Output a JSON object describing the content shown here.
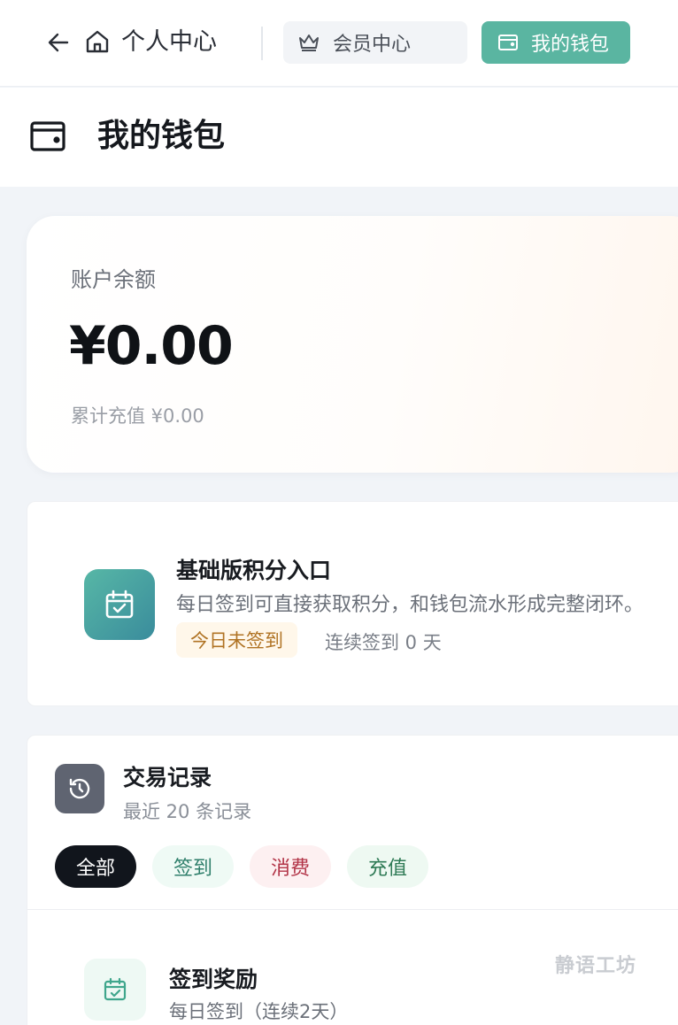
{
  "nav": {
    "title": "个人中心",
    "tabs": [
      {
        "label": "会员中心",
        "icon": "crown-icon"
      },
      {
        "label": "我的钱包",
        "icon": "wallet-icon",
        "active": true
      }
    ],
    "accent": "#5ab5a1"
  },
  "page": {
    "title": "我的钱包",
    "icon": "wallet-icon"
  },
  "balance": {
    "label": "账户余额",
    "amount": "¥0.00",
    "total": "累计充值 ¥0.00"
  },
  "checkin": {
    "title": "基础版积分入口",
    "desc": "每日签到可直接获取积分，和钱包流水形成完整闭环。",
    "status": "今日未签到",
    "streak": "连续签到 0 天",
    "icon": "calendar-check-icon"
  },
  "transactions": {
    "title": "交易记录",
    "subtitle": "最近 20 条记录",
    "icon": "history-icon",
    "filters": [
      "全部",
      "签到",
      "消费",
      "充值"
    ],
    "items": [
      {
        "title": "签到奖励",
        "desc": "每日签到（连续2天）",
        "icon": "calendar-check-icon"
      }
    ]
  },
  "watermark": "静语工坊"
}
